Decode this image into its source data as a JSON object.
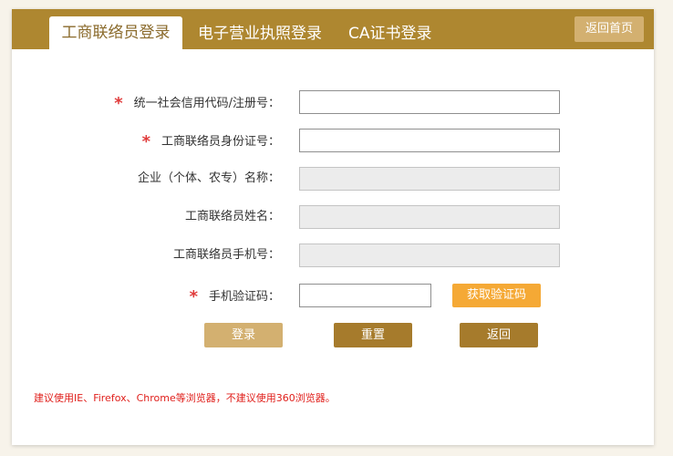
{
  "tabs": [
    {
      "label": "工商联络员登录",
      "active": true
    },
    {
      "label": "电子营业执照登录",
      "active": false
    },
    {
      "label": "CA证书登录",
      "active": false
    }
  ],
  "home_button": "返回首页",
  "form": {
    "credit_code": {
      "label": "统一社会信用代码/注册号：",
      "required": true,
      "value": ""
    },
    "liaison_id": {
      "label": "工商联络员身份证号：",
      "required": true,
      "value": ""
    },
    "enterprise_name": {
      "label": "企业（个体、农专）名称：",
      "required": false,
      "value": ""
    },
    "liaison_name": {
      "label": "工商联络员姓名：",
      "required": false,
      "value": ""
    },
    "liaison_phone": {
      "label": "工商联络员手机号：",
      "required": false,
      "value": ""
    },
    "sms_code": {
      "label": "手机验证码：",
      "required": true,
      "value": ""
    },
    "required_mark": "*",
    "get_code_button": "获取验证码"
  },
  "actions": {
    "login": "登录",
    "reset": "重置",
    "back": "返回"
  },
  "notice": "建议使用IE、Firefox、Chrome等浏览器，不建议使用360浏览器。",
  "colors": {
    "brand": "#ae8730",
    "login_button": "#d3b070",
    "dark_button": "#a67b2c",
    "code_button": "#f5a935",
    "required_mark": "#e03b3b",
    "notice_text": "#e0201c"
  }
}
